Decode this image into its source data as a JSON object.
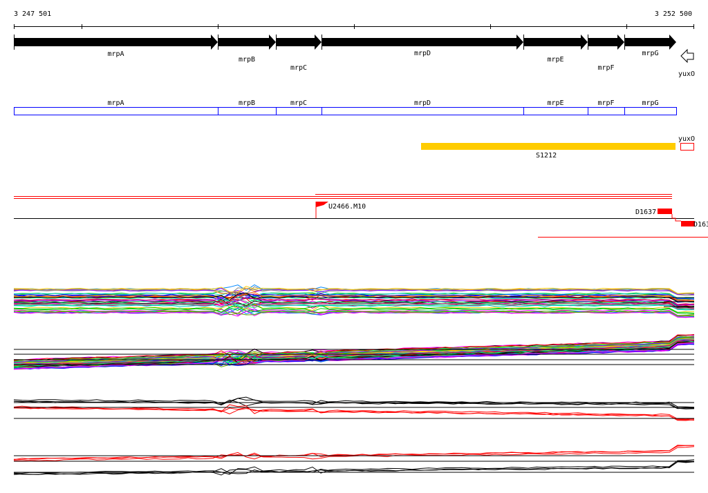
{
  "ruler": {
    "start": "3 247 501",
    "end": "3 252 500"
  },
  "genes": [
    {
      "name": "mrpA",
      "strand": "+"
    },
    {
      "name": "mrpB",
      "strand": "+"
    },
    {
      "name": "mrpC",
      "strand": "+"
    },
    {
      "name": "mrpD",
      "strand": "+"
    },
    {
      "name": "mrpE",
      "strand": "+"
    },
    {
      "name": "mrpF",
      "strand": "+"
    },
    {
      "name": "mrpG",
      "strand": "+"
    },
    {
      "name": "yuxO",
      "strand": "-"
    }
  ],
  "cds_track": [
    "mrpA",
    "mrpB",
    "mrpC",
    "mrpD",
    "mrpE",
    "mrpF",
    "mrpG",
    "yuxO"
  ],
  "features": {
    "segment": "S1212",
    "marker": "U2466.M10",
    "d1": "D1637",
    "d2": "D163"
  },
  "colors": {
    "gene": "#000000",
    "cds": "#0000ff",
    "segment": "#ffcc00",
    "feature": "#ff0000",
    "traces": [
      "#ff0000",
      "#00cc00",
      "#0000ff",
      "#ff00ff",
      "#00cccc",
      "#ff8800",
      "#8800ff",
      "#000000",
      "#888888",
      "#00ff88",
      "#cc0066",
      "#66aa00",
      "#ffcc00",
      "#0088ff"
    ]
  }
}
